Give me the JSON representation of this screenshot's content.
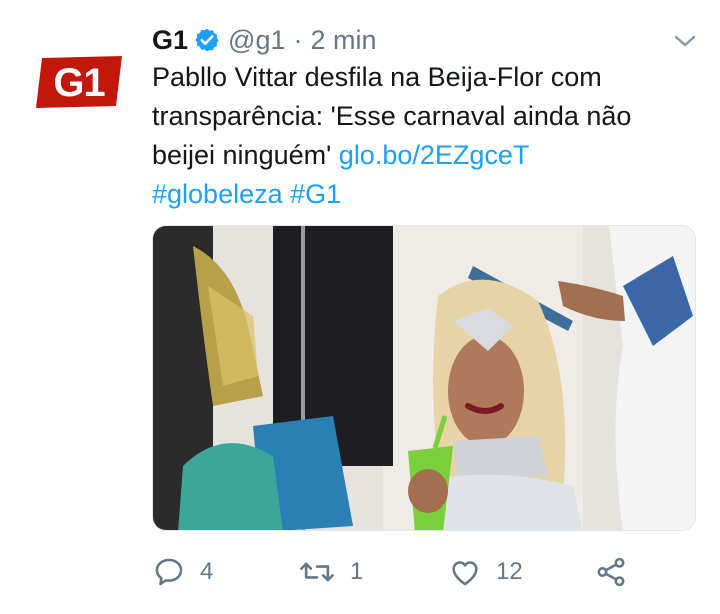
{
  "tweet": {
    "author": {
      "logo_text": "G1",
      "display_name": "G1",
      "handle": "@g1",
      "separator": "·",
      "time": "2 min"
    },
    "text_plain": "Pabllo Vittar desfila na Beija-Flor com transparência: 'Esse carnaval ainda não beijei ninguém'",
    "link": "glo.bo/2EZgceT",
    "hashtags": [
      "#globeleza",
      "#G1"
    ],
    "icons": {
      "verified": "verified-badge-icon",
      "menu": "chevron-down-icon",
      "reply": "reply-icon",
      "retweet": "retweet-icon",
      "like": "heart-icon",
      "share": "share-icon"
    },
    "actions": {
      "reply_count": "4",
      "retweet_count": "1",
      "like_count": "12"
    },
    "colors": {
      "brand_red": "#c4170c",
      "link_blue": "#1da1f2",
      "verified_blue": "#1da1f2",
      "muted_gray": "#657786"
    }
  }
}
